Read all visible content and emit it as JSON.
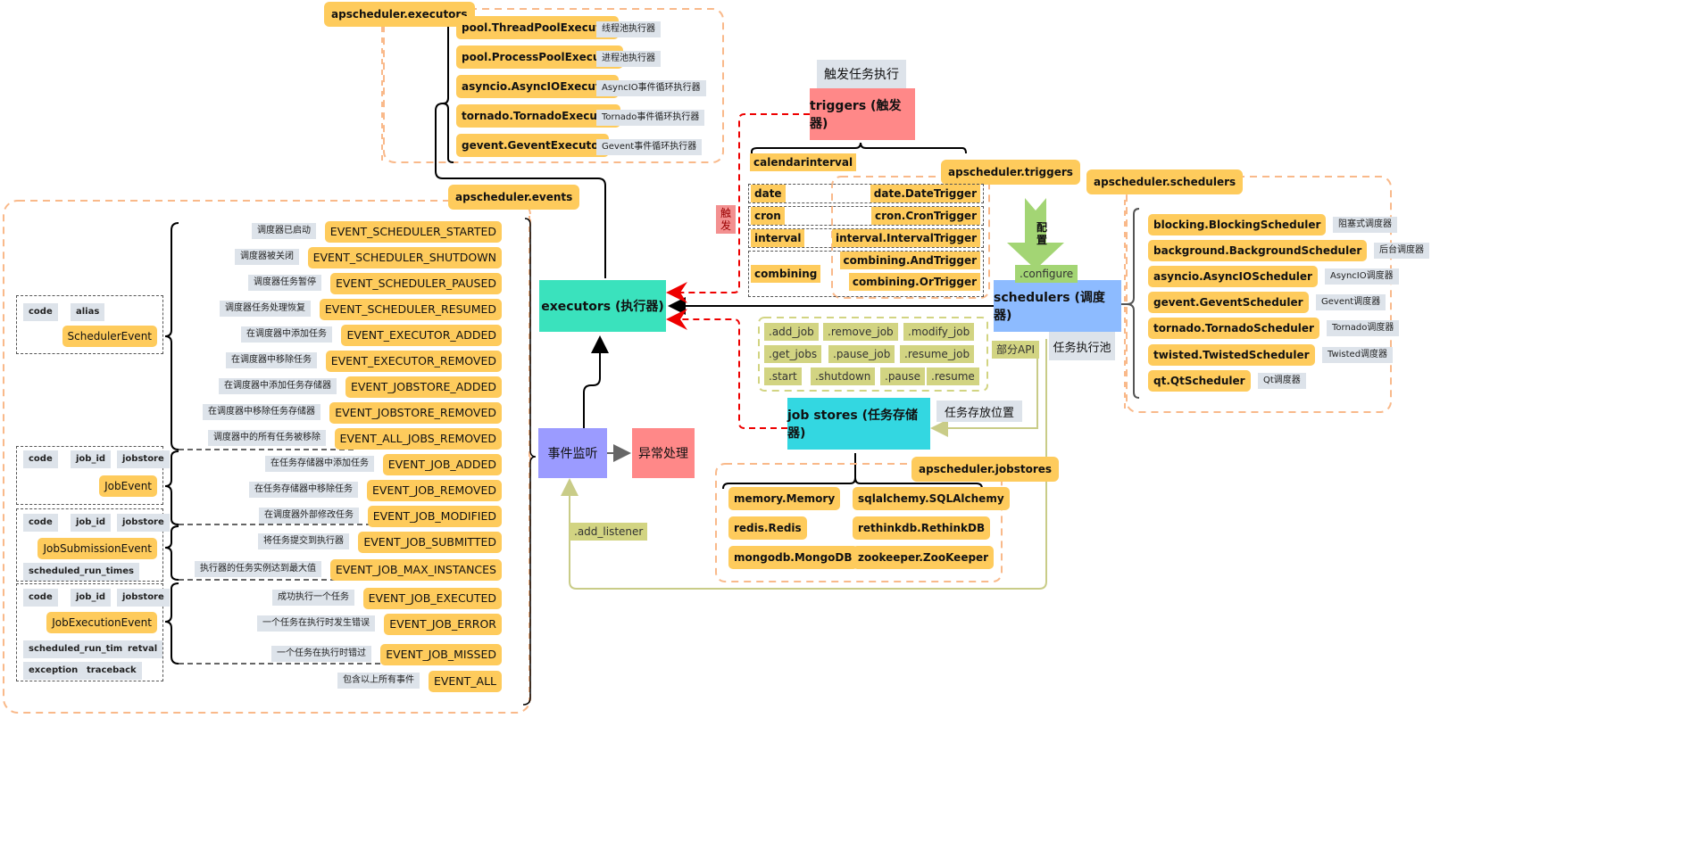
{
  "executors_module": {
    "label": "apscheduler.executors",
    "items": [
      {
        "name": "pool.ThreadPoolExecutor",
        "desc": "线程池执行器"
      },
      {
        "name": "pool.ProcessPoolExecutor",
        "desc": "进程池执行器"
      },
      {
        "name": "asyncio.AsyncIOExecutor",
        "desc": "AsyncIO事件循环执行器"
      },
      {
        "name": "tornado.TornadoExecutor",
        "desc": "Tornado事件循环执行器"
      },
      {
        "name": "gevent.GeventExecutor",
        "desc": "Gevent事件循环执行器"
      }
    ]
  },
  "events_module": {
    "label": "apscheduler.events",
    "event_classes": [
      {
        "name": "SchedulerEvent",
        "attrs": [
          "code",
          "alias"
        ]
      },
      {
        "name": "JobEvent",
        "attrs": [
          "code",
          "job_id",
          "jobstore"
        ]
      },
      {
        "name": "JobSubmissionEvent",
        "attrs": [
          "code",
          "job_id",
          "jobstore",
          "scheduled_run_times"
        ]
      },
      {
        "name": "JobExecutionEvent",
        "attrs": [
          "code",
          "job_id",
          "jobstore",
          "scheduled_run_time",
          "retval",
          "exception",
          "traceback"
        ]
      }
    ],
    "events": [
      {
        "name": "EVENT_SCHEDULER_STARTED",
        "desc": "调度器已启动"
      },
      {
        "name": "EVENT_SCHEDULER_SHUTDOWN",
        "desc": "调度器被关闭"
      },
      {
        "name": "EVENT_SCHEDULER_PAUSED",
        "desc": "调度器任务暂停"
      },
      {
        "name": "EVENT_SCHEDULER_RESUMED",
        "desc": "调度器任务处理恢复"
      },
      {
        "name": "EVENT_EXECUTOR_ADDED",
        "desc": "在调度器中添加任务"
      },
      {
        "name": "EVENT_EXECUTOR_REMOVED",
        "desc": "在调度器中移除任务"
      },
      {
        "name": "EVENT_JOBSTORE_ADDED",
        "desc": "在调度器中添加任务存储器"
      },
      {
        "name": "EVENT_JOBSTORE_REMOVED",
        "desc": "在调度器中移除任务存储器"
      },
      {
        "name": "EVENT_ALL_JOBS_REMOVED",
        "desc": "调度器中的所有任务被移除"
      },
      {
        "name": "EVENT_JOB_ADDED",
        "desc": "在任务存储器中添加任务"
      },
      {
        "name": "EVENT_JOB_REMOVED",
        "desc": "在任务存储器中移除任务"
      },
      {
        "name": "EVENT_JOB_MODIFIED",
        "desc": "在调度器外部修改任务"
      },
      {
        "name": "EVENT_JOB_SUBMITTED",
        "desc": "将任务提交到执行器"
      },
      {
        "name": "EVENT_JOB_MAX_INSTANCES",
        "desc": "执行器的任务实例达到最大值"
      },
      {
        "name": "EVENT_JOB_EXECUTED",
        "desc": "成功执行一个任务"
      },
      {
        "name": "EVENT_JOB_ERROR",
        "desc": "一个任务在执行时发生错误"
      },
      {
        "name": "EVENT_JOB_MISSED",
        "desc": "一个任务在执行时错过"
      },
      {
        "name": "EVENT_ALL",
        "desc": "包含以上所有事件"
      }
    ]
  },
  "core": {
    "executors": "executors (执行器)",
    "listener": "事件监听",
    "exception": "异常处理",
    "triggers": "triggers (触发器)",
    "trigger_note": "触发任务执行",
    "trigger_tag": "触发",
    "schedulers": "schedulers (调度器)",
    "jobstores": "job stores (任务存储器)",
    "jobstores_note": "任务存放位置",
    "pool_note": "任务执行池",
    "configure_arrow": "配置",
    "configure": ".configure",
    "partial_api": "部分API",
    "add_listener": ".add_listener"
  },
  "triggers_module": {
    "label": "apscheduler.triggers",
    "calendarinterval": "calendarinterval",
    "rows": [
      {
        "alias": "date",
        "classes": [
          "date.DateTrigger"
        ]
      },
      {
        "alias": "cron",
        "classes": [
          "cron.CronTrigger"
        ]
      },
      {
        "alias": "interval",
        "classes": [
          "interval.IntervalTrigger"
        ]
      },
      {
        "alias": "combining",
        "classes": [
          "combining.AndTrigger",
          "combining.OrTrigger"
        ]
      }
    ]
  },
  "api": [
    ".add_job",
    ".remove_job",
    ".modify_job",
    ".get_jobs",
    ".pause_job",
    ".resume_job",
    ".start",
    ".shutdown",
    ".pause",
    ".resume"
  ],
  "schedulers_module": {
    "label": "apscheduler.schedulers",
    "items": [
      {
        "name": "blocking.BlockingScheduler",
        "desc": "阻塞式调度器"
      },
      {
        "name": "background.BackgroundScheduler",
        "desc": "后台调度器"
      },
      {
        "name": "asyncio.AsyncIOScheduler",
        "desc": "AsyncIO调度器"
      },
      {
        "name": "gevent.GeventScheduler",
        "desc": "Gevent调度器"
      },
      {
        "name": "tornado.TornadoScheduler",
        "desc": "Tornado调度器"
      },
      {
        "name": "twisted.TwistedScheduler",
        "desc": "Twisted调度器"
      },
      {
        "name": "qt.QtScheduler",
        "desc": "Qt调度器"
      }
    ]
  },
  "jobstores_module": {
    "label": "apscheduler.jobstores",
    "items": [
      "memory.Memory",
      "sqlalchemy.SQLAlchemy",
      "redis.Redis",
      "rethinkdb.RethinkDB",
      "mongodb.MongoDB",
      "zookeeper.ZooKeeper"
    ]
  }
}
